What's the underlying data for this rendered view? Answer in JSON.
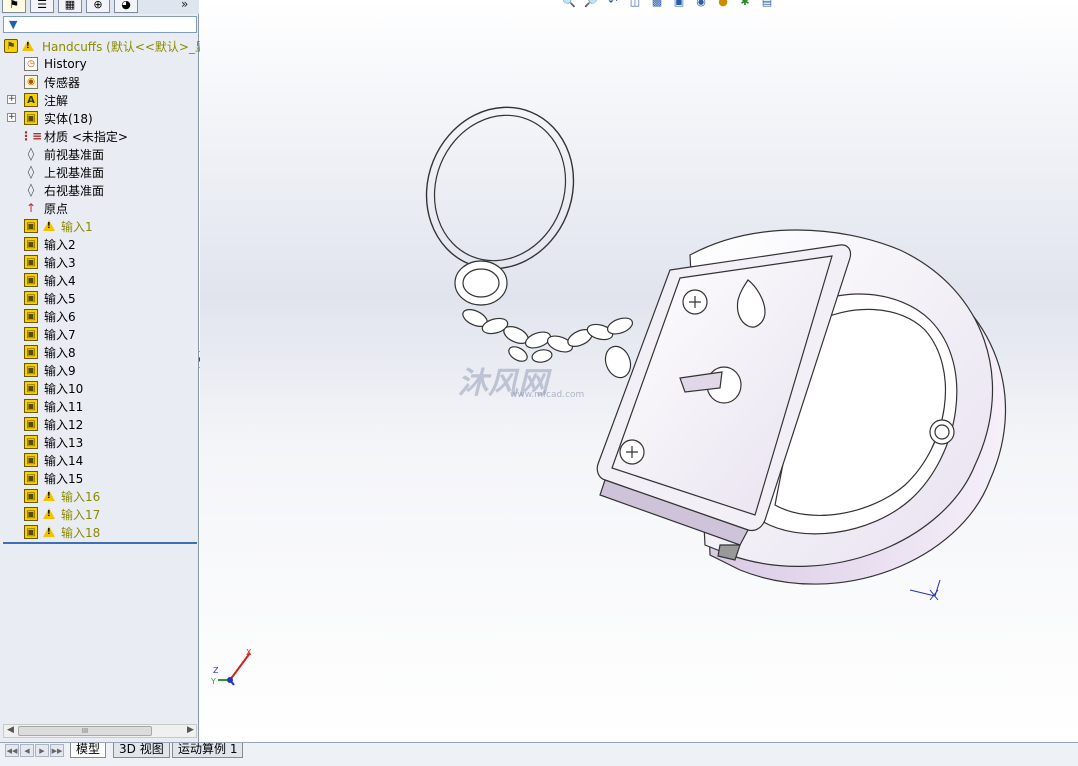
{
  "tree": {
    "root_label": "Handcuffs  (默认<<默认>_显",
    "items": [
      {
        "label": "History",
        "icon": "history-icon"
      },
      {
        "label": "传感器",
        "icon": "sensor-icon"
      },
      {
        "label": "注解",
        "icon": "annotation-icon"
      },
      {
        "label": "实体(18)",
        "icon": "solid-bodies-icon"
      },
      {
        "label": "材质 <未指定>",
        "icon": "material-icon"
      },
      {
        "label": "前视基准面",
        "icon": "plane-icon"
      },
      {
        "label": "上视基准面",
        "icon": "plane-icon"
      },
      {
        "label": "右视基准面",
        "icon": "plane-icon"
      },
      {
        "label": "原点",
        "icon": "origin-icon"
      },
      {
        "label": "输入1",
        "icon": "imported-body-icon",
        "warning": true
      },
      {
        "label": "输入2",
        "icon": "imported-body-icon"
      },
      {
        "label": "输入3",
        "icon": "imported-body-icon"
      },
      {
        "label": "输入4",
        "icon": "imported-body-icon"
      },
      {
        "label": "输入5",
        "icon": "imported-body-icon"
      },
      {
        "label": "输入6",
        "icon": "imported-body-icon"
      },
      {
        "label": "输入7",
        "icon": "imported-body-icon"
      },
      {
        "label": "输入8",
        "icon": "imported-body-icon"
      },
      {
        "label": "输入9",
        "icon": "imported-body-icon"
      },
      {
        "label": "输入10",
        "icon": "imported-body-icon"
      },
      {
        "label": "输入11",
        "icon": "imported-body-icon"
      },
      {
        "label": "输入12",
        "icon": "imported-body-icon"
      },
      {
        "label": "输入13",
        "icon": "imported-body-icon"
      },
      {
        "label": "输入14",
        "icon": "imported-body-icon"
      },
      {
        "label": "输入15",
        "icon": "imported-body-icon"
      },
      {
        "label": "输入16",
        "icon": "imported-body-icon",
        "warning": true
      },
      {
        "label": "输入17",
        "icon": "imported-body-icon",
        "warning": true
      },
      {
        "label": "输入18",
        "icon": "imported-body-icon",
        "warning": true
      }
    ]
  },
  "scrollbar": {
    "thumb_grip": "III"
  },
  "watermark": {
    "text": "沐风网",
    "url": "www.mfcad.com"
  },
  "triad": {
    "x": "X",
    "y": "Y",
    "z": "Z"
  },
  "bottom_tabs": [
    "模型",
    "3D 视图",
    "运动算例 1"
  ],
  "colors": {
    "panel_bg": "#e9edf3",
    "accent": "#3c6fb8",
    "warning": "#f2c200",
    "model_face": "#f1ecf6"
  }
}
